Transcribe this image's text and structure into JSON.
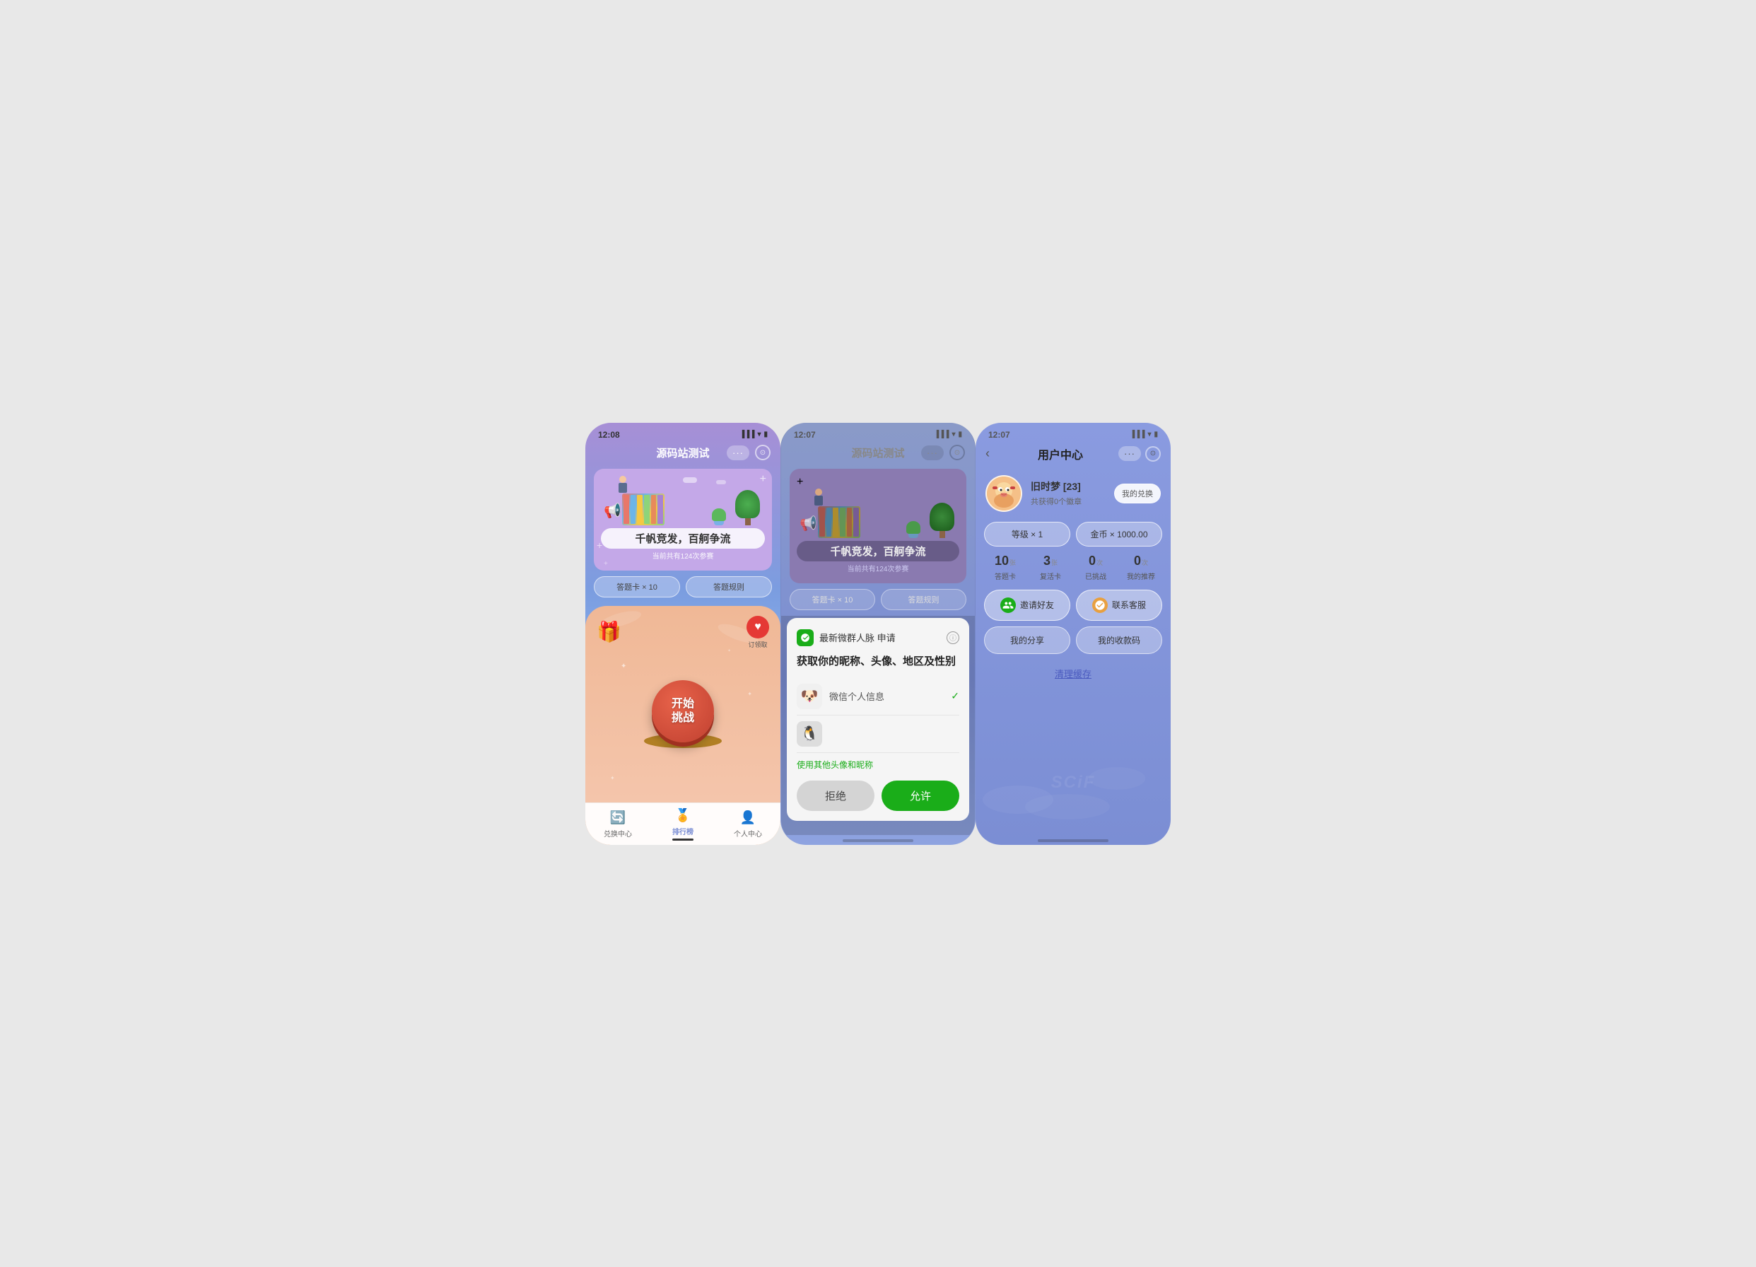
{
  "screens": [
    {
      "id": "screen1",
      "status_time": "12:08",
      "title": "源码站测试",
      "banner": {
        "main_title": "千帆竞发，百舸争流",
        "subtitle": "当前共有124次参赛",
        "btn1": "答题卡 × 10",
        "btn2": "答题规则"
      },
      "start_button": "开始\n挑战",
      "nav": [
        {
          "label": "兑换中心",
          "icon": "🔄",
          "active": false
        },
        {
          "label": "排行榜",
          "icon": "👤",
          "active": true
        },
        {
          "label": "个人中心",
          "icon": "👤",
          "active": false
        }
      ]
    },
    {
      "id": "screen2",
      "status_time": "12:07",
      "title": "源码站测试",
      "banner": {
        "main_title": "千帆竞发，百舸争流",
        "subtitle": "当前共有124次参赛",
        "btn1": "答题卡 × 10",
        "btn2": "答题规则"
      },
      "dialog": {
        "app_name": "最新微群人脉",
        "action": "申请",
        "title": "获取你的昵称、头像、地区及性别",
        "option1_label": "微信个人信息",
        "option1_checked": true,
        "link_text": "使用其他头像和昵称",
        "btn_reject": "拒绝",
        "btn_allow": "允许"
      }
    },
    {
      "id": "screen3",
      "status_time": "12:07",
      "title": "用户中心",
      "user": {
        "name": "旧时梦 [23]",
        "badges": "共获得0个徽章",
        "exchange_btn": "我的兑换"
      },
      "stats": [
        {
          "label": "等级 × 1"
        },
        {
          "label": "金币 × 1000.00"
        }
      ],
      "counts": [
        {
          "number": "10",
          "unit": "张",
          "label": "答题卡"
        },
        {
          "number": "3",
          "unit": "张",
          "label": "复活卡"
        },
        {
          "number": "0",
          "unit": "次",
          "label": "已挑战"
        },
        {
          "number": "0",
          "unit": "次",
          "label": "我的推荐"
        }
      ],
      "actions": [
        {
          "icon": "💬",
          "label": "邀请好友",
          "type": "invite"
        },
        {
          "icon": "👤",
          "label": "联系客服",
          "type": "service"
        }
      ],
      "wide_actions": [
        {
          "label": "我的分享"
        },
        {
          "label": "我的收款码"
        }
      ],
      "clear_cache": "清理缓存"
    }
  ]
}
